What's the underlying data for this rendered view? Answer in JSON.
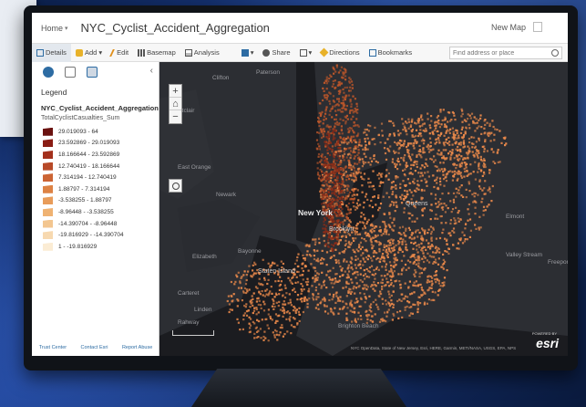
{
  "header": {
    "home_label": "Home",
    "map_title": "NYC_Cyclist_Accident_Aggregation",
    "new_map_label": "New Map"
  },
  "toolbar": {
    "details_label": "Details",
    "add_label": "Add",
    "edit_label": "Edit",
    "basemap_label": "Basemap",
    "analysis_label": "Analysis",
    "share_label": "Share",
    "directions_label": "Directions",
    "bookmarks_label": "Bookmarks",
    "search_placeholder": "Find address or place"
  },
  "panel": {
    "legend_title": "Legend",
    "layer_name": "NYC_Cyclist_Accident_Aggregation",
    "field_name": "TotalCyclistCasualties_Sum",
    "legend_items": [
      {
        "label": "29.019093 - 64",
        "color": "#6b1210"
      },
      {
        "label": "23.592869 - 29.019093",
        "color": "#8a1c14"
      },
      {
        "label": "18.166644 - 23.592869",
        "color": "#a3301c"
      },
      {
        "label": "12.740419 - 18.166644",
        "color": "#b84a28"
      },
      {
        "label": "7.314194 - 12.740419",
        "color": "#cc6434"
      },
      {
        "label": "1.88797 - 7.314194",
        "color": "#dd8244"
      },
      {
        "label": "-3.538255 - 1.88797",
        "color": "#e89c5a"
      },
      {
        "label": "-8.96448 - -3.538255",
        "color": "#efb272"
      },
      {
        "label": "-14.390704 - -8.96448",
        "color": "#f3c690"
      },
      {
        "label": "-19.816929 - -14.390704",
        "color": "#f7d9b0"
      },
      {
        "label": "1 - -19.816929",
        "color": "#fbecd4"
      }
    ],
    "footer": {
      "trust_center": "Trust Center",
      "contact_esri": "Contact Esri",
      "report_abuse": "Report Abuse"
    }
  },
  "map": {
    "zoom_in": "+",
    "zoom_out": "−",
    "places": [
      {
        "name": "Clifton",
        "cls": ""
      },
      {
        "name": "Paterson",
        "cls": ""
      },
      {
        "name": "Montclair",
        "cls": ""
      },
      {
        "name": "East Orange",
        "cls": ""
      },
      {
        "name": "Newark",
        "cls": ""
      },
      {
        "name": "Elizabeth",
        "cls": ""
      },
      {
        "name": "Bayonne",
        "cls": ""
      },
      {
        "name": "New York",
        "cls": "big"
      },
      {
        "name": "Brooklyn",
        "cls": "mid"
      },
      {
        "name": "Queens",
        "cls": "mid"
      },
      {
        "name": "Staten Island",
        "cls": "mid"
      },
      {
        "name": "Elmont",
        "cls": ""
      },
      {
        "name": "Valley Stream",
        "cls": ""
      },
      {
        "name": "Freeport",
        "cls": ""
      },
      {
        "name": "Brighton Beach",
        "cls": ""
      },
      {
        "name": "Carteret",
        "cls": ""
      },
      {
        "name": "Rahway",
        "cls": ""
      },
      {
        "name": "Linden",
        "cls": ""
      }
    ],
    "attribution": "NYC OpenData, State of New Jersey, Esri, HERE, Garmin, METI/NASA, USGS, EPA, NPS",
    "esri_powered": "POWERED BY",
    "esri_logo": "esri"
  },
  "colors": {
    "point_dark": "#b9552a",
    "point_light": "#e8884a",
    "water": "#1b1c20",
    "land": "#2c2e33"
  }
}
